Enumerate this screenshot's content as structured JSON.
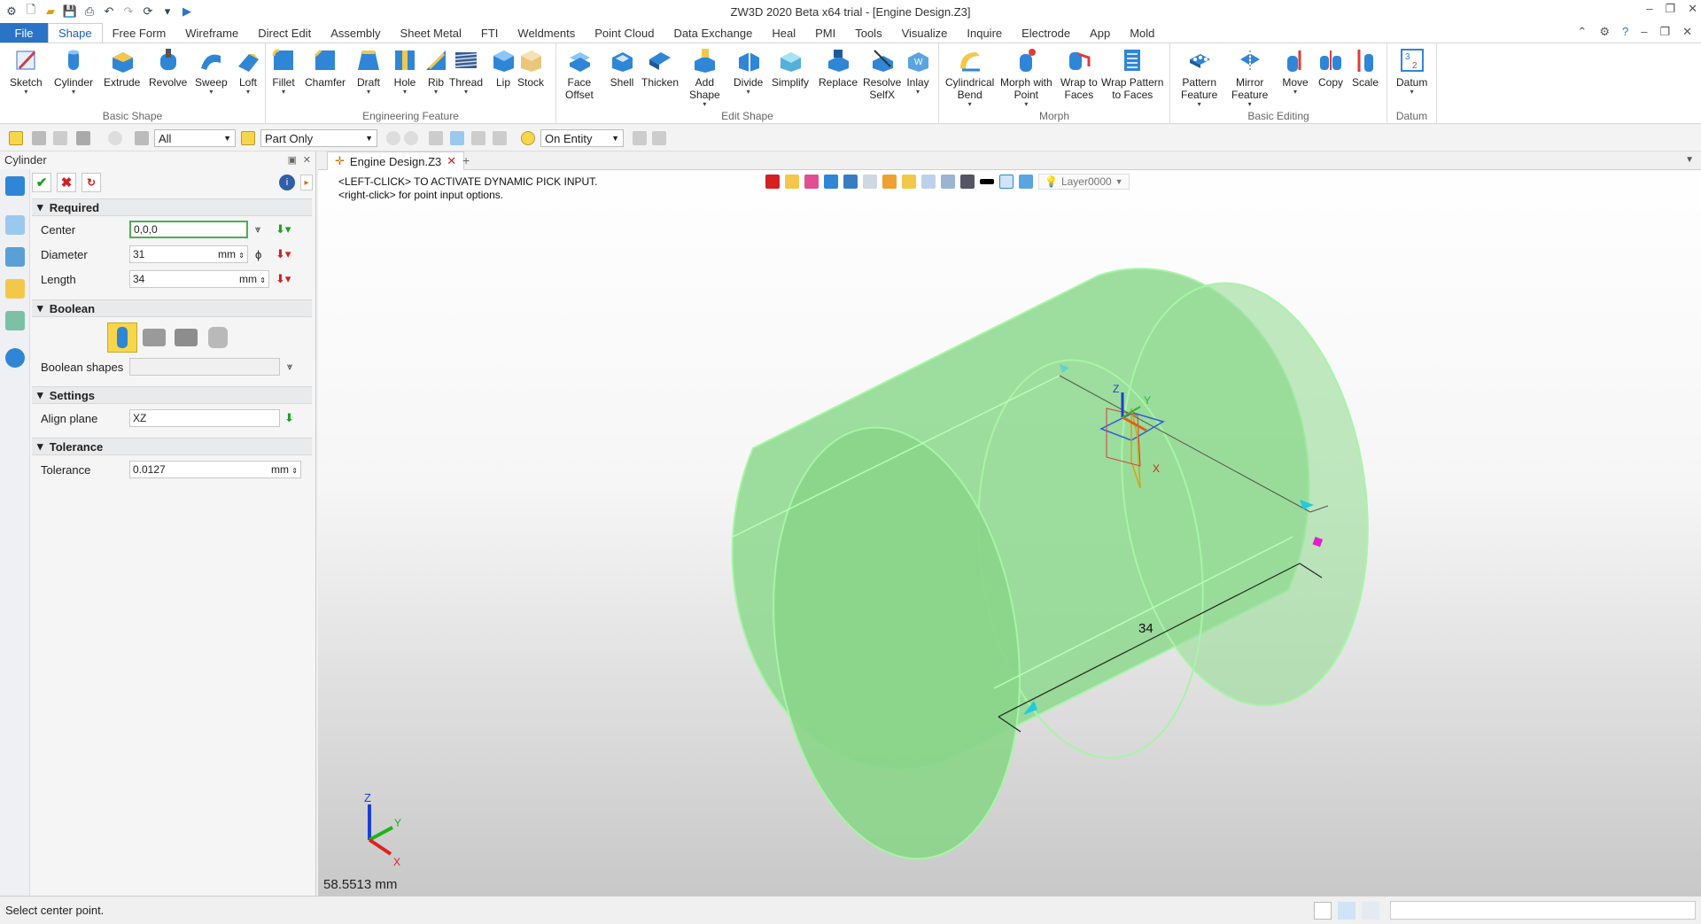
{
  "window": {
    "title": "ZW3D 2020 Beta x64 trial - [Engine Design.Z3]"
  },
  "menu": {
    "file": "File",
    "tabs": [
      "Shape",
      "Free Form",
      "Wireframe",
      "Direct Edit",
      "Assembly",
      "Sheet Metal",
      "FTI",
      "Weldments",
      "Point Cloud",
      "Data Exchange",
      "Heal",
      "PMI",
      "Tools",
      "Visualize",
      "Inquire",
      "Electrode",
      "App",
      "Mold"
    ],
    "active_tab": "Shape"
  },
  "ribbon": {
    "groups": {
      "basic_shape": "Basic Shape",
      "engineering_feature": "Engineering Feature",
      "edit_shape": "Edit Shape",
      "morph": "Morph",
      "basic_editing": "Basic Editing",
      "datum": "Datum"
    },
    "buttons": {
      "sketch": "Sketch",
      "cylinder": "Cylinder",
      "extrude": "Extrude",
      "revolve": "Revolve",
      "sweep": "Sweep",
      "loft": "Loft",
      "fillet": "Fillet",
      "chamfer": "Chamfer",
      "draft": "Draft",
      "hole": "Hole",
      "rib": "Rib",
      "thread": "Thread",
      "lip": "Lip",
      "stock": "Stock",
      "face_offset_1": "Face",
      "face_offset_2": "Offset",
      "shell": "Shell",
      "thicken": "Thicken",
      "add_shape_1": "Add",
      "add_shape_2": "Shape",
      "divide": "Divide",
      "simplify": "Simplify",
      "replace": "Replace",
      "resolve_1": "Resolve",
      "resolve_2": "SelfX",
      "inlay": "Inlay",
      "cyl_bend_1": "Cylindrical",
      "cyl_bend_2": "Bend",
      "morph_point_1": "Morph with",
      "morph_point_2": "Point",
      "wrap_faces_1": "Wrap to",
      "wrap_faces_2": "Faces",
      "wrap_pattern_1": "Wrap Pattern",
      "wrap_pattern_2": "to Faces",
      "pattern_1": "Pattern",
      "pattern_2": "Feature",
      "mirror_1": "Mirror",
      "mirror_2": "Feature",
      "move": "Move",
      "copy": "Copy",
      "scale": "Scale",
      "datum": "Datum"
    }
  },
  "toolbar2": {
    "filter": "All",
    "scope": "Part Only",
    "snap": "On Entity"
  },
  "panel": {
    "title": "Cylinder",
    "sections": {
      "required": "Required",
      "boolean": "Boolean",
      "settings": "Settings",
      "tolerance": "Tolerance"
    },
    "center": {
      "label": "Center",
      "value": "0,0,0"
    },
    "diameter": {
      "label": "Diameter",
      "value": "31",
      "unit": "mm"
    },
    "length": {
      "label": "Length",
      "value": "34",
      "unit": "mm"
    },
    "boolean_shapes": {
      "label": "Boolean shapes",
      "value": ""
    },
    "align_plane": {
      "label": "Align plane",
      "value": "XZ"
    },
    "tolerance": {
      "label": "Tolerance",
      "value": "0.0127",
      "unit": "mm"
    }
  },
  "document": {
    "tab": "Engine Design.Z3"
  },
  "viewport": {
    "prompt1": "<LEFT-CLICK> TO ACTIVATE DYNAMIC PICK INPUT.",
    "prompt2": "<right-click> for point input options.",
    "layer": "Layer0000",
    "dimension": "34",
    "measure": "58.5513 mm",
    "triad": {
      "z": "Z",
      "y": "Y",
      "x": "X"
    }
  },
  "status": {
    "text": "Select center point."
  },
  "colors": {
    "accent": "#2b73c6",
    "cylinder_fill": "#8fd88f",
    "cylinder_edge": "#9af59a",
    "axis_x": "#e02020",
    "axis_y": "#19b519",
    "axis_z": "#1b3fd6"
  }
}
